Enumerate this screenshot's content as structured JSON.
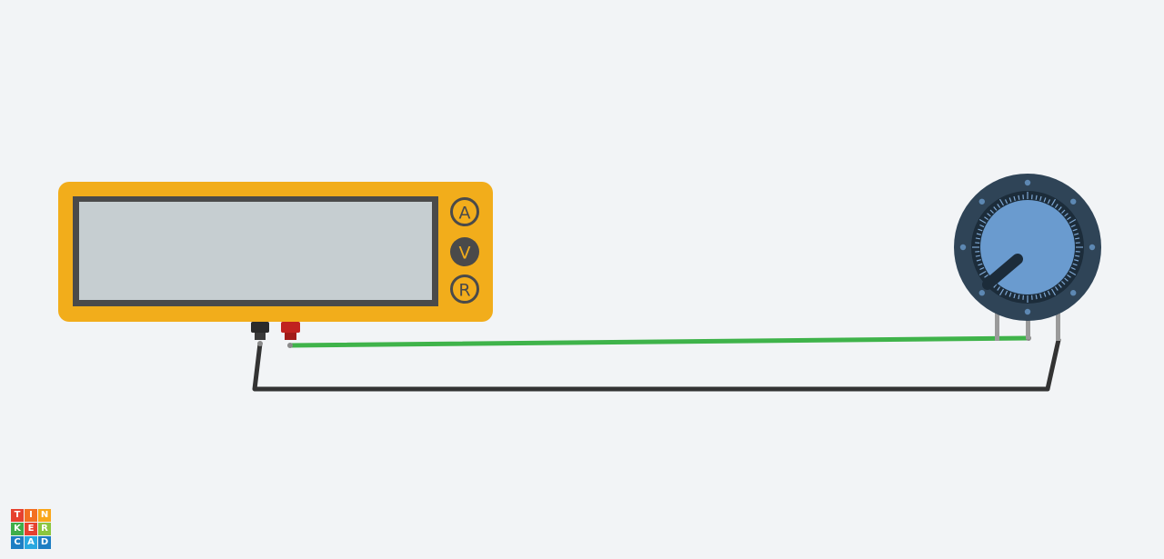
{
  "multimeter": {
    "modes": [
      {
        "label": "A",
        "selected": false
      },
      {
        "label": "V",
        "selected": true
      },
      {
        "label": "R",
        "selected": false
      }
    ]
  },
  "colors": {
    "background": "#f2f4f6",
    "multimeter_body": "#f2ad1b",
    "display": "#c6ced1",
    "display_frame": "#4a4a4a",
    "mode_selected": "#4a4a4a",
    "probe_black": "#2b2b2b",
    "probe_red": "#c0221f",
    "wire_green": "#3fb34a",
    "wire_black": "#333333",
    "pot_body": "#2f4457",
    "pot_knob": "#6a9bcf",
    "pot_pin": "#9a9a9a"
  },
  "logo": {
    "letters": [
      {
        "char": "T",
        "color": "#e6412f"
      },
      {
        "char": "I",
        "color": "#f37021"
      },
      {
        "char": "N",
        "color": "#f9a61a"
      },
      {
        "char": "K",
        "color": "#3fae49"
      },
      {
        "char": "E",
        "color": "#e6412f"
      },
      {
        "char": "R",
        "color": "#8cc63f"
      },
      {
        "char": "C",
        "color": "#1e7ec3"
      },
      {
        "char": "A",
        "color": "#29a8e0"
      },
      {
        "char": "D",
        "color": "#1e7ec3"
      }
    ]
  }
}
